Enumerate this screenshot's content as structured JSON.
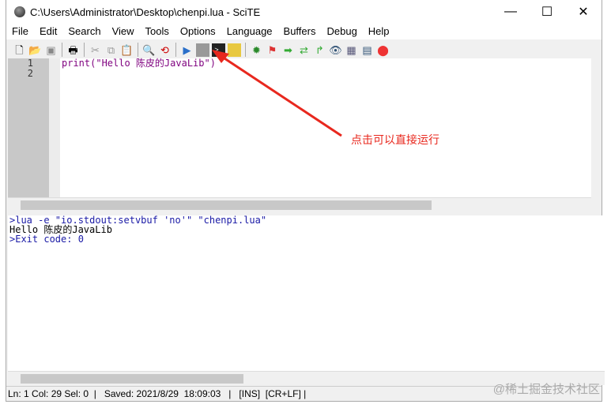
{
  "title": "C:\\Users\\Administrator\\Desktop\\chenpi.lua - SciTE",
  "window_controls": {
    "minimize": "—",
    "maximize": "☐",
    "close": "✕"
  },
  "menu": [
    "File",
    "Edit",
    "Search",
    "View",
    "Tools",
    "Options",
    "Language",
    "Buffers",
    "Debug",
    "Help"
  ],
  "editor": {
    "line_numbers": [
      "1",
      "2"
    ],
    "code_line1": "print(\"Hello 陈皮的JavaLib\")"
  },
  "output": {
    "line1": ">lua -e \"io.stdout:setvbuf 'no'\" \"chenpi.lua\"",
    "line2": "Hello 陈皮的JavaLib",
    "line3": ">Exit code: 0"
  },
  "status": "Ln: 1 Col: 29 Sel: 0  |   Saved: 2021/8/29  18:09:03   |   [INS]  [CR+LF] |",
  "annotation": "点击可以直接运行",
  "watermark": "@稀土掘金技术社区",
  "colors": {
    "accent": "#e8281e",
    "code": "#7f007f",
    "output_cmd": "#1a1aa6"
  }
}
